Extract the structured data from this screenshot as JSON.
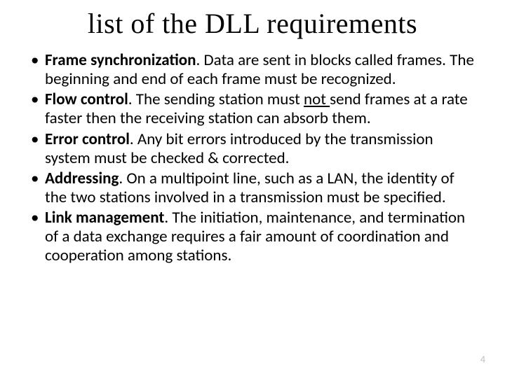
{
  "title": "list of the DLL requirements",
  "items": [
    {
      "term": "Frame synchronization",
      "dot": ".",
      "pre": " Data are sent in blocks called frames. The beginning and end of each frame must be recognized."
    },
    {
      "term": "Flow control",
      "dot": ".",
      "pre": " The sending station must ",
      "underline": "not ",
      "post": "send frames at a rate faster then the receiving station can absorb them."
    },
    {
      "term": "Error control",
      "dot": ".",
      "pre": " Any bit errors introduced by the transmission system must be checked & corrected."
    },
    {
      "term": "Addressing",
      "dot": ".",
      "pre": " On a multipoint line, such as a LAN, the identity of the two stations involved in a transmission must be specified."
    },
    {
      "term": "Link management",
      "dot": ".",
      "pre": " The initiation, maintenance, and termination of a data exchange requires a fair amount of coordination and cooperation among stations."
    }
  ],
  "page_number": "4"
}
